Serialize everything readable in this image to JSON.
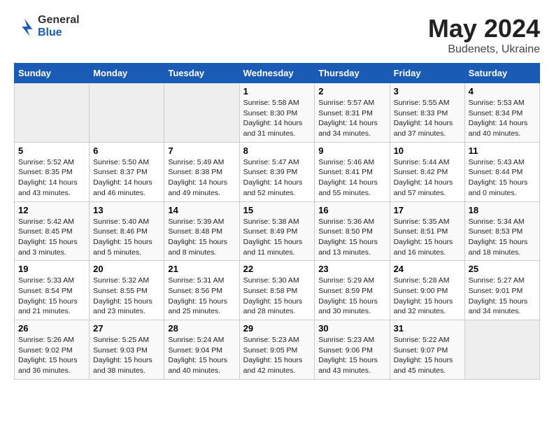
{
  "header": {
    "logo_general": "General",
    "logo_blue": "Blue",
    "main_title": "May 2024",
    "subtitle": "Budenets, Ukraine"
  },
  "weekdays": [
    "Sunday",
    "Monday",
    "Tuesday",
    "Wednesday",
    "Thursday",
    "Friday",
    "Saturday"
  ],
  "weeks": [
    [
      {
        "day": "",
        "info": ""
      },
      {
        "day": "",
        "info": ""
      },
      {
        "day": "",
        "info": ""
      },
      {
        "day": "1",
        "info": "Sunrise: 5:58 AM\nSunset: 8:30 PM\nDaylight: 14 hours\nand 31 minutes."
      },
      {
        "day": "2",
        "info": "Sunrise: 5:57 AM\nSunset: 8:31 PM\nDaylight: 14 hours\nand 34 minutes."
      },
      {
        "day": "3",
        "info": "Sunrise: 5:55 AM\nSunset: 8:33 PM\nDaylight: 14 hours\nand 37 minutes."
      },
      {
        "day": "4",
        "info": "Sunrise: 5:53 AM\nSunset: 8:34 PM\nDaylight: 14 hours\nand 40 minutes."
      }
    ],
    [
      {
        "day": "5",
        "info": "Sunrise: 5:52 AM\nSunset: 8:35 PM\nDaylight: 14 hours\nand 43 minutes."
      },
      {
        "day": "6",
        "info": "Sunrise: 5:50 AM\nSunset: 8:37 PM\nDaylight: 14 hours\nand 46 minutes."
      },
      {
        "day": "7",
        "info": "Sunrise: 5:49 AM\nSunset: 8:38 PM\nDaylight: 14 hours\nand 49 minutes."
      },
      {
        "day": "8",
        "info": "Sunrise: 5:47 AM\nSunset: 8:39 PM\nDaylight: 14 hours\nand 52 minutes."
      },
      {
        "day": "9",
        "info": "Sunrise: 5:46 AM\nSunset: 8:41 PM\nDaylight: 14 hours\nand 55 minutes."
      },
      {
        "day": "10",
        "info": "Sunrise: 5:44 AM\nSunset: 8:42 PM\nDaylight: 14 hours\nand 57 minutes."
      },
      {
        "day": "11",
        "info": "Sunrise: 5:43 AM\nSunset: 8:44 PM\nDaylight: 15 hours\nand 0 minutes."
      }
    ],
    [
      {
        "day": "12",
        "info": "Sunrise: 5:42 AM\nSunset: 8:45 PM\nDaylight: 15 hours\nand 3 minutes."
      },
      {
        "day": "13",
        "info": "Sunrise: 5:40 AM\nSunset: 8:46 PM\nDaylight: 15 hours\nand 5 minutes."
      },
      {
        "day": "14",
        "info": "Sunrise: 5:39 AM\nSunset: 8:48 PM\nDaylight: 15 hours\nand 8 minutes."
      },
      {
        "day": "15",
        "info": "Sunrise: 5:38 AM\nSunset: 8:49 PM\nDaylight: 15 hours\nand 11 minutes."
      },
      {
        "day": "16",
        "info": "Sunrise: 5:36 AM\nSunset: 8:50 PM\nDaylight: 15 hours\nand 13 minutes."
      },
      {
        "day": "17",
        "info": "Sunrise: 5:35 AM\nSunset: 8:51 PM\nDaylight: 15 hours\nand 16 minutes."
      },
      {
        "day": "18",
        "info": "Sunrise: 5:34 AM\nSunset: 8:53 PM\nDaylight: 15 hours\nand 18 minutes."
      }
    ],
    [
      {
        "day": "19",
        "info": "Sunrise: 5:33 AM\nSunset: 8:54 PM\nDaylight: 15 hours\nand 21 minutes."
      },
      {
        "day": "20",
        "info": "Sunrise: 5:32 AM\nSunset: 8:55 PM\nDaylight: 15 hours\nand 23 minutes."
      },
      {
        "day": "21",
        "info": "Sunrise: 5:31 AM\nSunset: 8:56 PM\nDaylight: 15 hours\nand 25 minutes."
      },
      {
        "day": "22",
        "info": "Sunrise: 5:30 AM\nSunset: 8:58 PM\nDaylight: 15 hours\nand 28 minutes."
      },
      {
        "day": "23",
        "info": "Sunrise: 5:29 AM\nSunset: 8:59 PM\nDaylight: 15 hours\nand 30 minutes."
      },
      {
        "day": "24",
        "info": "Sunrise: 5:28 AM\nSunset: 9:00 PM\nDaylight: 15 hours\nand 32 minutes."
      },
      {
        "day": "25",
        "info": "Sunrise: 5:27 AM\nSunset: 9:01 PM\nDaylight: 15 hours\nand 34 minutes."
      }
    ],
    [
      {
        "day": "26",
        "info": "Sunrise: 5:26 AM\nSunset: 9:02 PM\nDaylight: 15 hours\nand 36 minutes."
      },
      {
        "day": "27",
        "info": "Sunrise: 5:25 AM\nSunset: 9:03 PM\nDaylight: 15 hours\nand 38 minutes."
      },
      {
        "day": "28",
        "info": "Sunrise: 5:24 AM\nSunset: 9:04 PM\nDaylight: 15 hours\nand 40 minutes."
      },
      {
        "day": "29",
        "info": "Sunrise: 5:23 AM\nSunset: 9:05 PM\nDaylight: 15 hours\nand 42 minutes."
      },
      {
        "day": "30",
        "info": "Sunrise: 5:23 AM\nSunset: 9:06 PM\nDaylight: 15 hours\nand 43 minutes."
      },
      {
        "day": "31",
        "info": "Sunrise: 5:22 AM\nSunset: 9:07 PM\nDaylight: 15 hours\nand 45 minutes."
      },
      {
        "day": "",
        "info": ""
      }
    ]
  ]
}
